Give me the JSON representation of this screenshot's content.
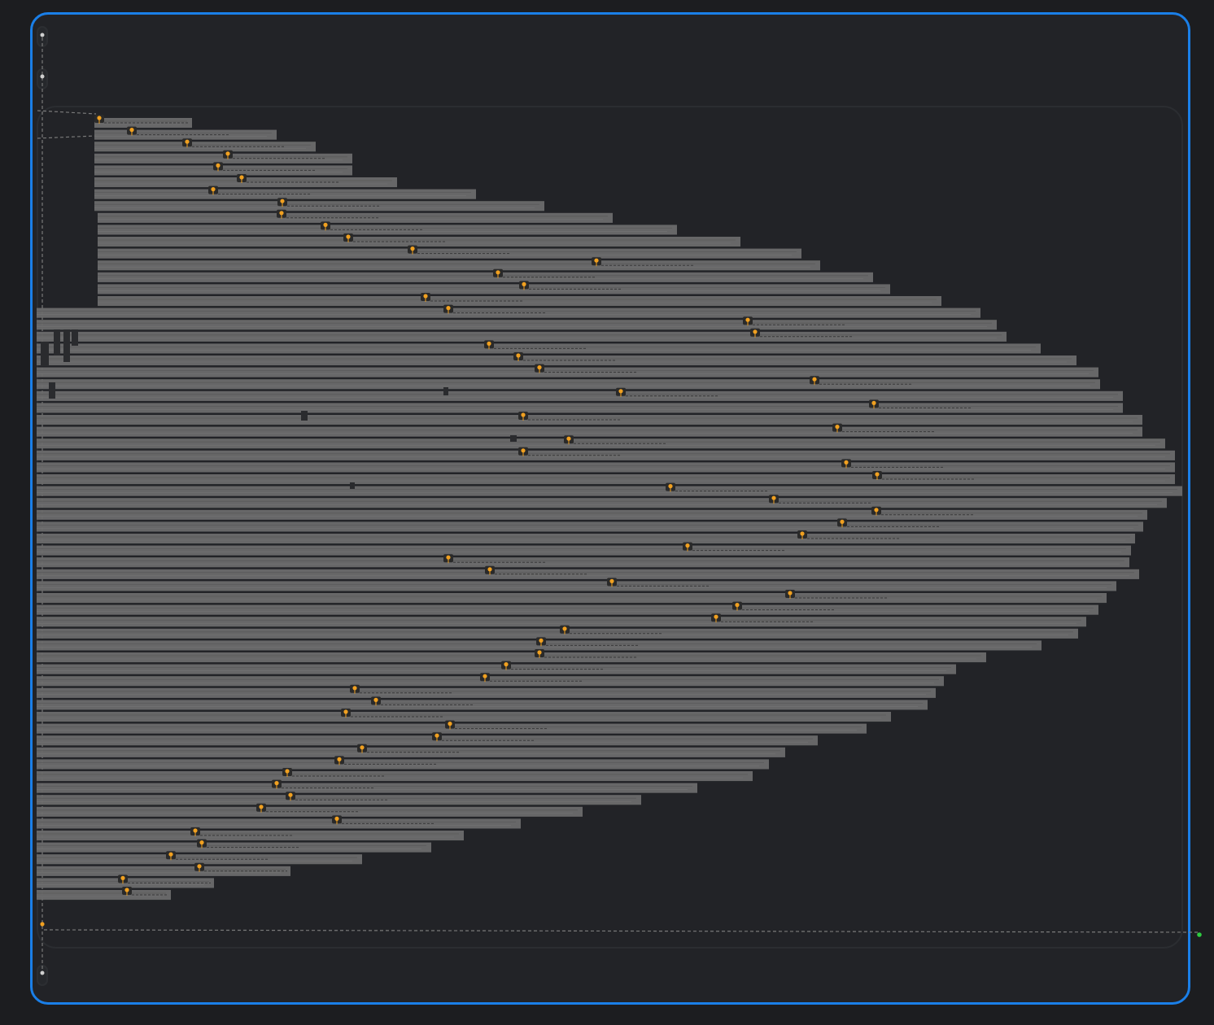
{
  "canvas": {
    "title": "",
    "background_color": "#1c1d20",
    "frame_color": "#1a7fe8",
    "bar_color": "#6b6b6b",
    "bar_highlight_color": "#8a8a8a",
    "marker_color": "#f0a020",
    "marker_bg_color": "#2a2a2a",
    "end_dot_color": "#2ecc40",
    "connector_color": "#7a7a7a"
  },
  "graph": {
    "row_count": 66,
    "marker_count": 66,
    "icons": [
      "start-node-icon",
      "step-node-icon",
      "marker-pin-icon",
      "end-dot-icon",
      "exit-node-icon"
    ]
  }
}
